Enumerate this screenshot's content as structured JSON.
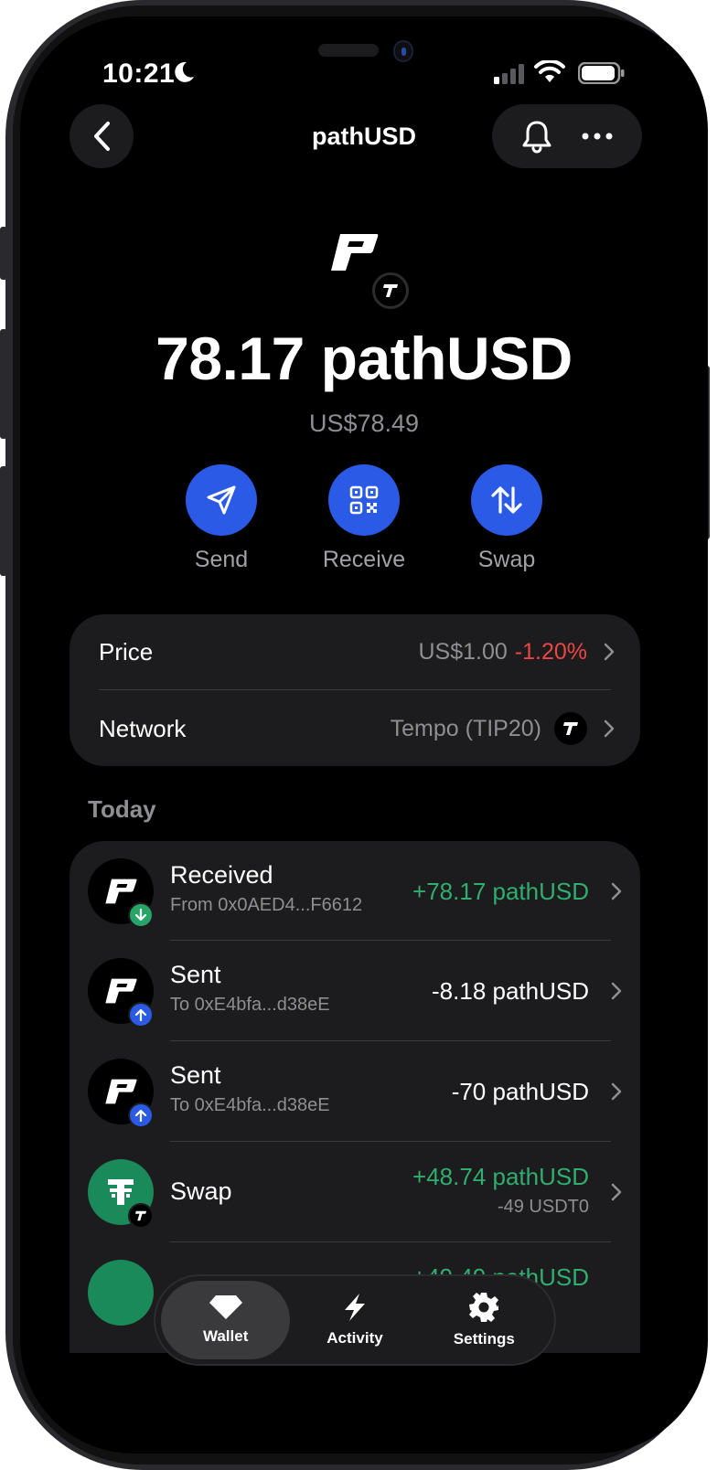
{
  "status_bar": {
    "time": "10:21"
  },
  "header": {
    "title": "pathUSD"
  },
  "token": {
    "balance": "78.17 pathUSD",
    "fiat_value": "US$78.49"
  },
  "actions": [
    {
      "label": "Send",
      "icon": "send-icon"
    },
    {
      "label": "Receive",
      "icon": "qr-code-icon"
    },
    {
      "label": "Swap",
      "icon": "swap-arrows-icon"
    }
  ],
  "info": {
    "price_label": "Price",
    "price_value": "US$1.00",
    "price_change": "-1.20%",
    "network_label": "Network",
    "network_value": "Tempo (TIP20)"
  },
  "section_title": "Today",
  "transactions": [
    {
      "title": "Received",
      "subtitle": "From 0x0AED4...F6612",
      "amount": "+78.17 pathUSD",
      "sub_amount": ""
    },
    {
      "title": "Sent",
      "subtitle": "To 0xE4bfa...d38eE",
      "amount": "-8.18 pathUSD",
      "sub_amount": ""
    },
    {
      "title": "Sent",
      "subtitle": "To 0xE4bfa...d38eE",
      "amount": "-70 pathUSD",
      "sub_amount": ""
    },
    {
      "title": "Swap",
      "subtitle": "",
      "amount": "+48.74 pathUSD",
      "sub_amount": "-49 USDT0"
    },
    {
      "title": "",
      "subtitle": "",
      "amount": "+49.49 pathUSD",
      "sub_amount": ""
    }
  ],
  "tabs": [
    {
      "label": "Wallet",
      "icon": "diamond-icon"
    },
    {
      "label": "Activity",
      "icon": "lightning-icon"
    },
    {
      "label": "Settings",
      "icon": "gear-icon"
    }
  ],
  "colors": {
    "accent": "#2b5be6",
    "positive": "#2fae6e",
    "negative": "#ef4444",
    "card": "#1c1c1e"
  }
}
